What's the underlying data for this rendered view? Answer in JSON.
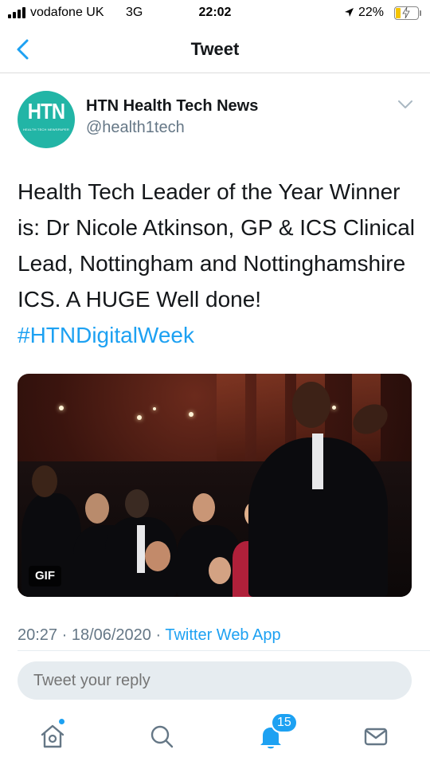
{
  "status_bar": {
    "carrier": "vodafone UK",
    "network": "3G",
    "time": "22:02",
    "battery_percent": "22%",
    "battery_level": 0.22,
    "icons": [
      "signal-icon",
      "location-arrow-icon",
      "battery-charging-icon"
    ]
  },
  "nav": {
    "title": "Tweet",
    "back_icon": "chevron-left-icon"
  },
  "tweet": {
    "avatar": {
      "logo_text": "HTN",
      "tagline": "HEALTH TECH NEWSPAPER",
      "color": "#22b5a6"
    },
    "display_name": "HTN Health Tech News",
    "handle": "@health1tech",
    "more_icon": "chevron-down-icon",
    "text": "Health Tech Leader of the Year Winner is: Dr Nicole Atkinson, GP & ICS Clinical Lead, Nottingham and Nottinghamshire ICS. A HUGE Well done! ",
    "hashtag": "#HTNDigitalWeek",
    "media": {
      "type": "gif",
      "badge": "GIF"
    },
    "timestamp": "20:27 · 18/06/2020 · ",
    "source_app": "Twitter Web App"
  },
  "reply": {
    "placeholder": "Tweet your reply"
  },
  "tab_bar": {
    "items": [
      {
        "name": "home",
        "icon": "home-icon",
        "has_dot": true
      },
      {
        "name": "search",
        "icon": "search-icon"
      },
      {
        "name": "notifications",
        "icon": "bell-icon",
        "badge": "15"
      },
      {
        "name": "messages",
        "icon": "mail-icon"
      }
    ]
  },
  "colors": {
    "accent": "#1da1f2",
    "secondary_text": "#657786",
    "primary_text": "#14171a",
    "reply_bg": "#e6ecf0"
  }
}
